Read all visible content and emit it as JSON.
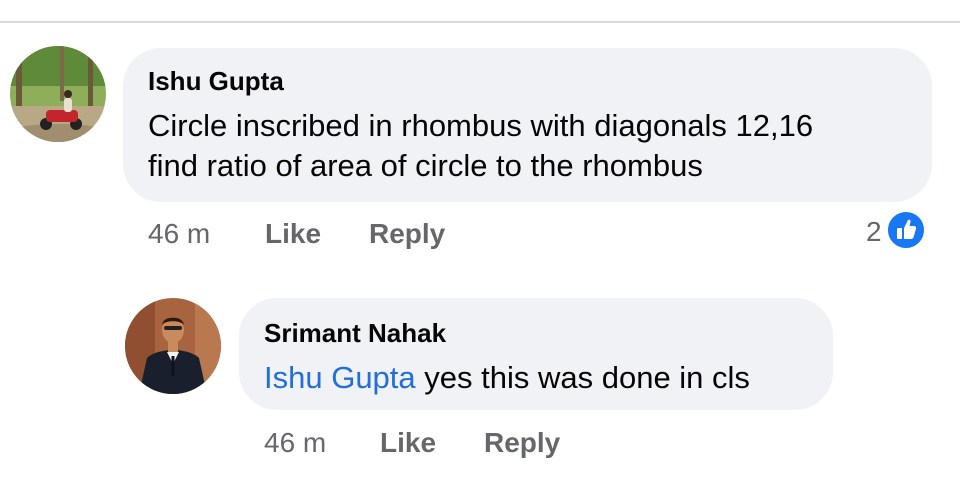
{
  "comments": [
    {
      "author": "Ishu Gupta",
      "lines": [
        "Circle inscribed in rhombus with diagonals 12,16",
        "find ratio of area of circle to the rhombus"
      ],
      "time": "46 m",
      "like_label": "Like",
      "reply_label": "Reply",
      "reaction_count": "2",
      "reaction_icon": "like-thumb-icon"
    },
    {
      "author": "Srimant Nahak",
      "mention": "Ishu Gupta",
      "text": " yes this was done in cls",
      "time": "46 m",
      "like_label": "Like",
      "reply_label": "Reply"
    }
  ],
  "colors": {
    "bubble": "#f0f2f5",
    "mention": "#216fdb",
    "meta": "#65676b",
    "like_blue": "#1877f2"
  }
}
